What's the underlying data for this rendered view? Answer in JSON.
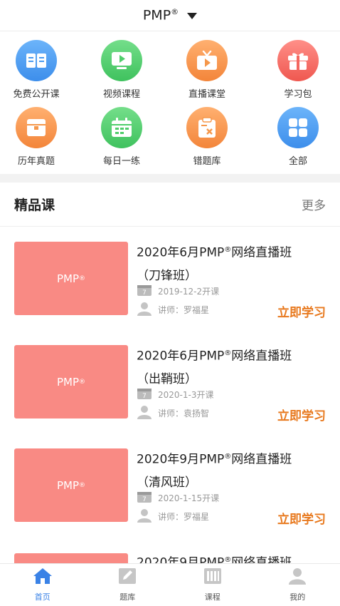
{
  "header": {
    "title": "PMP",
    "title_sup": "®"
  },
  "categories": [
    {
      "label": "免费公开课",
      "icon": "open-book-icon",
      "color": "#4a9bf0"
    },
    {
      "label": "视频课程",
      "icon": "video-play-icon",
      "color": "#4fcd6a"
    },
    {
      "label": "直播课堂",
      "icon": "live-tv-icon",
      "color": "#f5974a"
    },
    {
      "label": "学习包",
      "icon": "gift-box-icon",
      "color": "#f4675f"
    },
    {
      "label": "历年真题",
      "icon": "archive-box-icon",
      "color": "#f5974a"
    },
    {
      "label": "每日一练",
      "icon": "calendar-icon",
      "color": "#4fcd6a"
    },
    {
      "label": "错题库",
      "icon": "clipboard-x-icon",
      "color": "#f5974a"
    },
    {
      "label": "全部",
      "icon": "grid-four-icon",
      "color": "#4a9bf0"
    }
  ],
  "section": {
    "title": "精品课",
    "more": "更多"
  },
  "courses": [
    {
      "thumb_text": "PMP",
      "thumb_sup": "®",
      "name_pre": "2020年6月PMP",
      "name_sup": "®",
      "name_post": "网络直播班",
      "name_line2": "（刀锋班）",
      "date": "2019-12-2开课",
      "teacher": "讲师：罗福星",
      "cta": "立即学习"
    },
    {
      "thumb_text": "PMP",
      "thumb_sup": "®",
      "name_pre": "2020年6月PMP",
      "name_sup": "®",
      "name_post": "网络直播班",
      "name_line2": "（出鞘班）",
      "date": "2020-1-3开课",
      "teacher": "讲师：袁扬智",
      "cta": "立即学习"
    },
    {
      "thumb_text": "PMP",
      "thumb_sup": "®",
      "name_pre": "2020年9月PMP",
      "name_sup": "®",
      "name_post": "网络直播班",
      "name_line2": "（清风班）",
      "date": "2020-1-15开课",
      "teacher": "讲师：罗福星",
      "cta": "立即学习"
    },
    {
      "name_pre": "2020年9月PMP",
      "name_sup": "®",
      "name_post": "网络直播班"
    }
  ],
  "tabbar": [
    {
      "label": "首页",
      "icon": "home-icon",
      "active": true
    },
    {
      "label": "题库",
      "icon": "edit-pencil-icon",
      "active": false
    },
    {
      "label": "课程",
      "icon": "books-icon",
      "active": false
    },
    {
      "label": "我的",
      "icon": "user-icon",
      "active": false
    }
  ],
  "colors": {
    "accent": "#3a82e6",
    "cta": "#e8791e",
    "thumb": "#f98a84"
  }
}
